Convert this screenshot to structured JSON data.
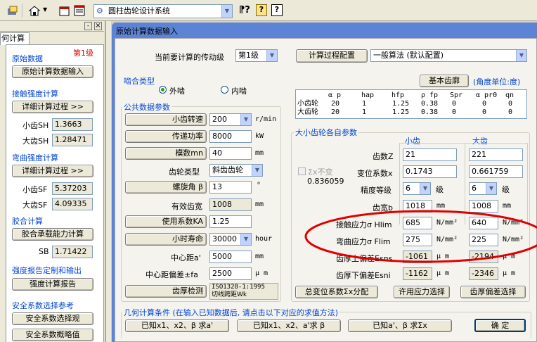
{
  "toolbar": {
    "icons": [
      "tools-icon",
      "home-icon",
      "window-icon",
      "panel-icon"
    ],
    "dropdown_value": "圆柱齿轮设计系统",
    "help_icons": [
      "whatsthis-icon",
      "note-icon",
      "help-icon"
    ]
  },
  "sidebar": {
    "tab": "何计算",
    "pin": "‑",
    "close": "×",
    "orig_title": "原始数据",
    "stage": "第1级",
    "orig_btn": "原始计算数据输入",
    "contact_title": "接触强度计算",
    "contact_btn": "详细计算过程   >>",
    "sh1_label": "小齿SH",
    "sh1": "1.3663",
    "sh2_label": "大齿SH",
    "sh2": "1.28471",
    "bend_title": "弯曲强度计算",
    "bend_btn": "详细计算过程   >>",
    "sf1_label": "小齿SF",
    "sf1": "5.37203",
    "sf2_label": "大齿SF",
    "sf2": "4.09335",
    "glue_title": "胶合计算",
    "glue_btn": "胶合承载能力计算",
    "sb_label": "SB",
    "sb": "1.71422",
    "report_title": "强度报告定制和输出",
    "report_btn": "强度计算报告",
    "safety_title": "安全系数选择参考",
    "safety_btn1": "安全系数选择观",
    "safety_btn2": "安全系数概略值"
  },
  "panel": {
    "title": "原始计算数据输入",
    "stage_label": "当前要计算的传动级",
    "stage_value": "第1级",
    "config_btn": "计算过程配置",
    "algo_value": "一般算法 (默认配置)",
    "mesh_title": "啮合类型",
    "mesh_outer": "外啮",
    "mesh_inner": "内啮",
    "rack_btn": "基本齿廓",
    "angle_unit": "(角度单位:度)",
    "rack_table": {
      "headers": [
        "",
        "α p",
        "hap",
        "hfp",
        "ρ fp",
        "Spr",
        "α pr0",
        "qn"
      ],
      "rows": [
        [
          "小齿轮",
          "20",
          "1",
          "1.25",
          "0.38",
          "0",
          "0",
          "0"
        ],
        [
          "大齿轮",
          "20",
          "1",
          "1.25",
          "0.38",
          "0",
          "0",
          "0"
        ]
      ]
    },
    "common_title": "公共数据参数",
    "speed_label": "小齿转速",
    "speed": "200",
    "speed_unit": "r/min",
    "power_label": "传递功率",
    "power": "8000",
    "power_unit": "kW",
    "module_label": "模数mn",
    "module": "40",
    "module_unit": "mm",
    "geartype_label": "齿轮类型",
    "geartype": "斜齿齿轮",
    "helix_label": "螺旋角 β",
    "helix": "13",
    "helix_unit": "°",
    "width_label": "有效齿宽",
    "width": "1008",
    "width_unit": "mm",
    "ka_label": "使用系数KA",
    "ka": "1.25",
    "life_label": "小时寿命",
    "life": "30000",
    "life_unit": "hour",
    "center_label": "中心距a'",
    "center": "5000",
    "center_unit": "mm",
    "fa_label": "中心距偏差±fa",
    "fa": "2500",
    "fa_unit": "μ m",
    "inspect_btn": "齿厚检测",
    "inspect_val1": "ISO1328-1:1995",
    "inspect_val2": "切线跨距Wk",
    "each_title": "大小齿轮各自参数",
    "small": "小齿",
    "large": "大齿",
    "z_label": "齿数Z",
    "z1": "21",
    "z2": "221",
    "sumx_check": "Σx不变",
    "sumx_val": "0.836059",
    "x_label": "变位系数x",
    "x1": "0.1743",
    "x2": "0.661759",
    "grade_label": "精度等级",
    "grade1": "6",
    "grade2": "6",
    "grade_unit": "级",
    "b_label": "齿宽b",
    "b1": "1018",
    "b2": "1008",
    "b_unit": "mm",
    "hlim_label": "接触应力σ Hlim",
    "hlim1": "685",
    "hlim2": "640",
    "stress_unit": "N/mm²",
    "flim_label": "弯曲应力σ Flim",
    "flim1": "275",
    "flim2": "225",
    "esns_label": "齿厚上偏差Esns",
    "esns1": "-1061",
    "esns2": "-2194",
    "um": "μ m",
    "esni_label": "齿厚下偏差Esni",
    "esni1": "-1162",
    "esni2": "-2346",
    "dist_btn": "总变位系数Σx分配",
    "stress_btn": "许用应力选择",
    "dev_btn": "齿厚偏差选择",
    "cond_title": "几何计算条件 (在输入已知数据后, 请点击以下对应的求值方法)",
    "cond_btn1": "已知x1、x2、β 求a'",
    "cond_btn2": "已知x1、x2、a'求 β",
    "cond_btn3": "已知a'、β 求Σx",
    "ok_btn": "确  定"
  },
  "colors": {
    "accent": "#0046d5",
    "annotation": "#e00000",
    "panel_bg": "#f4f3ee",
    "frame": "#5d83d7"
  }
}
